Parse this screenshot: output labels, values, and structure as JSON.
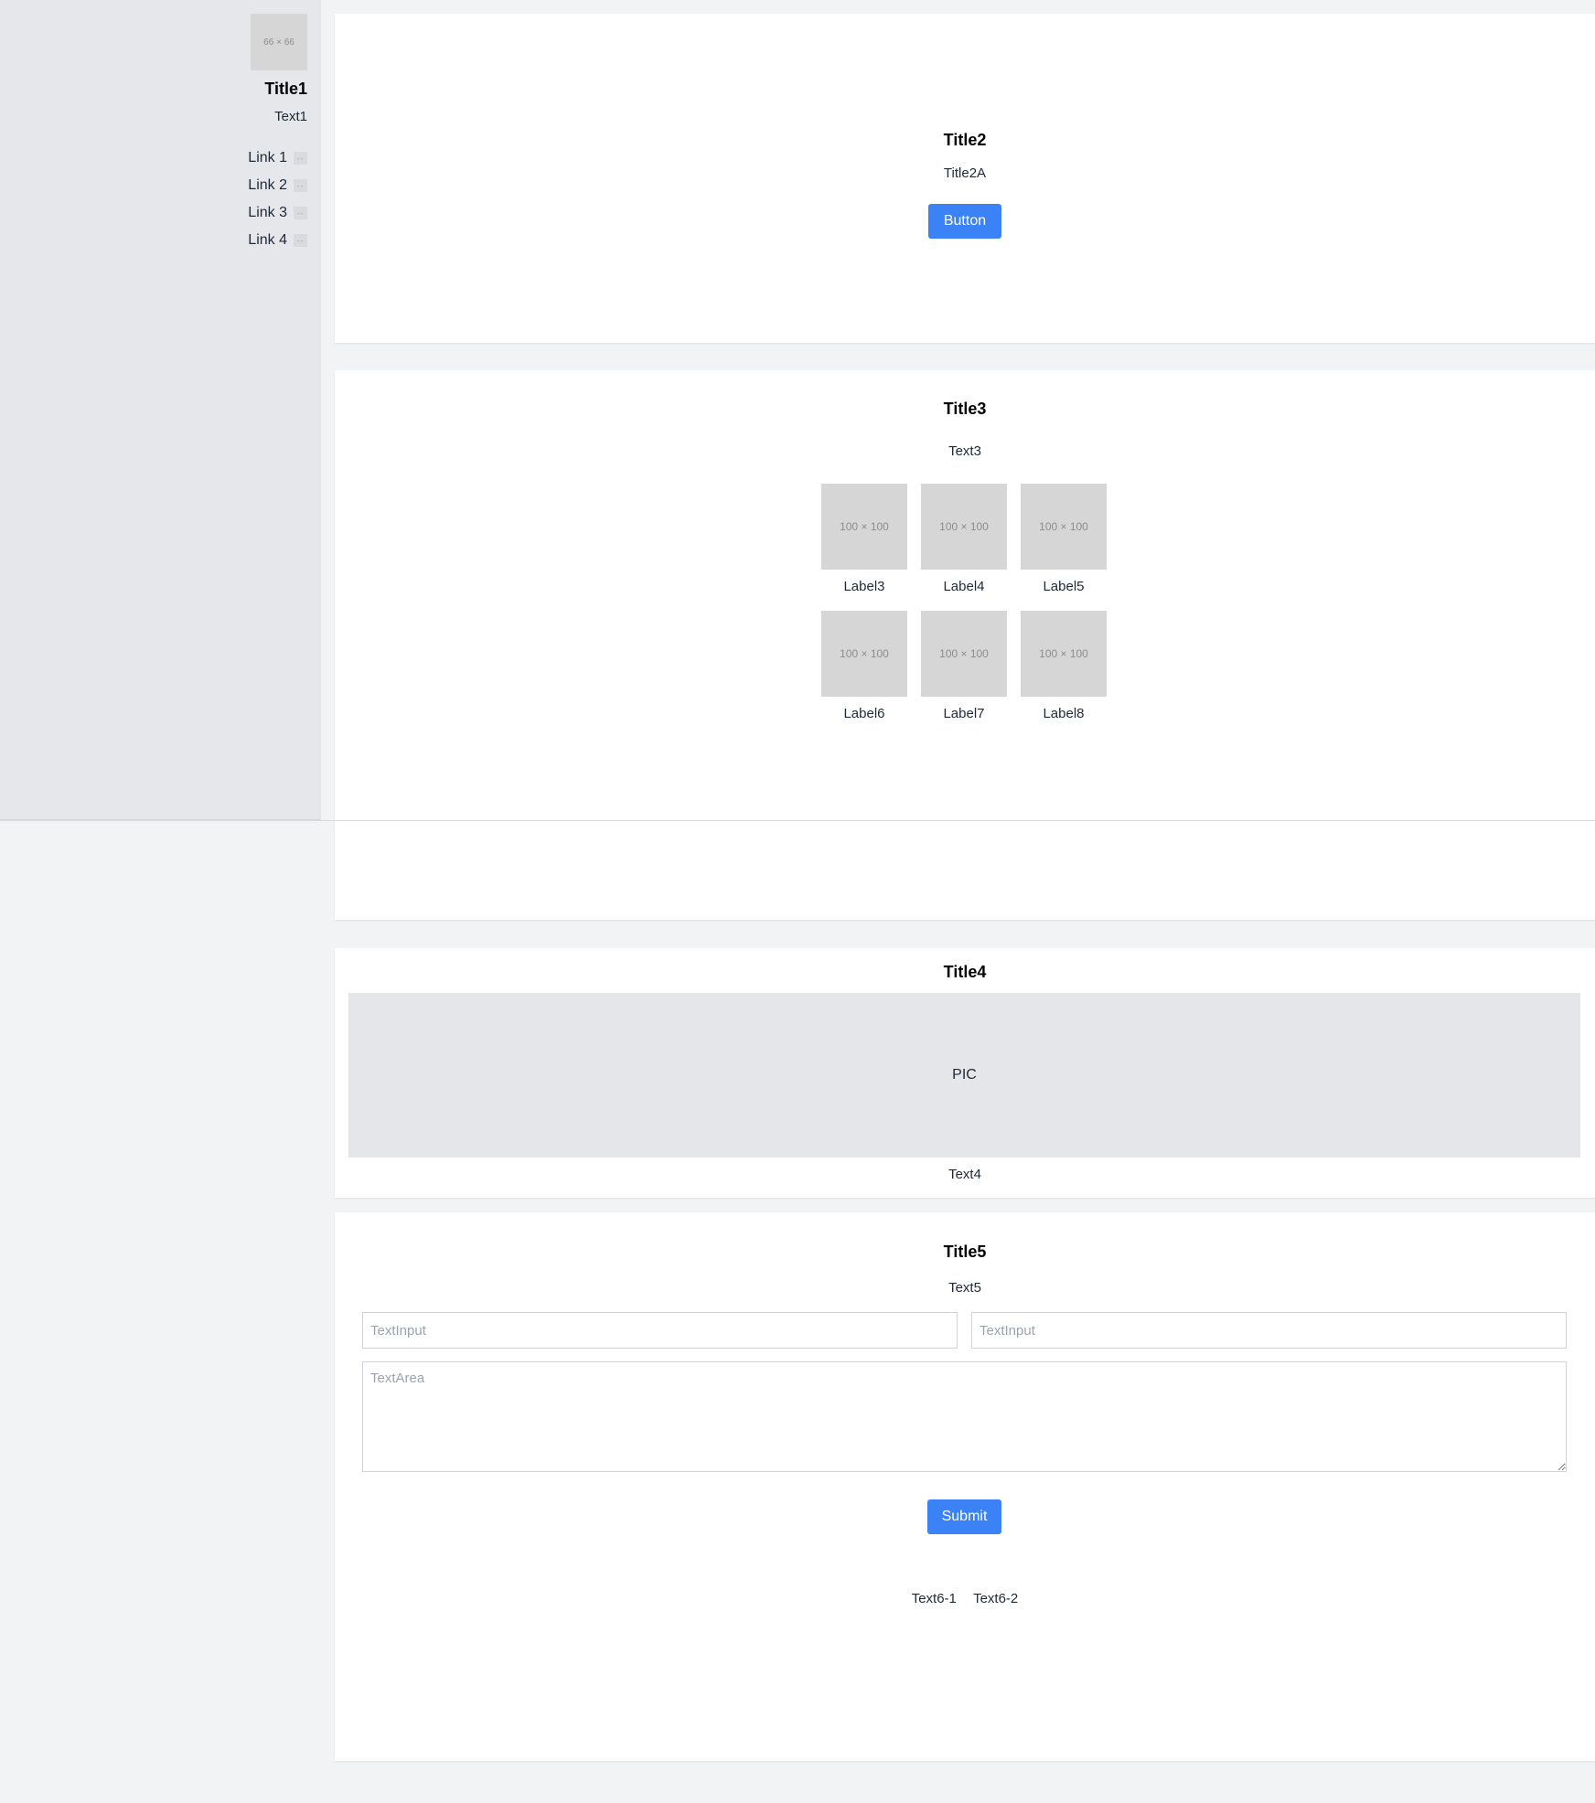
{
  "sidebar": {
    "avatar_label": "66 × 66",
    "title": "Title1",
    "text": "Text1",
    "links": [
      {
        "label": "Link 1",
        "badge": "--"
      },
      {
        "label": "Link 2",
        "badge": "--"
      },
      {
        "label": "Link 3",
        "badge": "--"
      },
      {
        "label": "Link 4",
        "badge": "--"
      }
    ]
  },
  "hero": {
    "title": "Title2",
    "subtitle": "Title2A",
    "button_label": "Button"
  },
  "gallery": {
    "title": "Title3",
    "text": "Text3",
    "items": [
      {
        "image": "100 × 100",
        "label": "Label3"
      },
      {
        "image": "100 × 100",
        "label": "Label4"
      },
      {
        "image": "100 × 100",
        "label": "Label5"
      },
      {
        "image": "100 × 100",
        "label": "Label6"
      },
      {
        "image": "100 × 100",
        "label": "Label7"
      },
      {
        "image": "100 × 100",
        "label": "Label8"
      }
    ]
  },
  "picture_section": {
    "title": "Title4",
    "pic_label": "PIC",
    "text": "Text4"
  },
  "form": {
    "title": "Title5",
    "text": "Text5",
    "input1_placeholder": "TextInput",
    "input2_placeholder": "TextInput",
    "textarea_placeholder": "TextArea",
    "submit_label": "Submit",
    "footer": [
      "Text6-1",
      "Text6-2"
    ]
  },
  "colors": {
    "accent": "#3b82f6",
    "sidebar_bg": "#e5e7eb",
    "page_bg": "#f2f3f5",
    "placeholder_bg": "#d6d6d6"
  }
}
